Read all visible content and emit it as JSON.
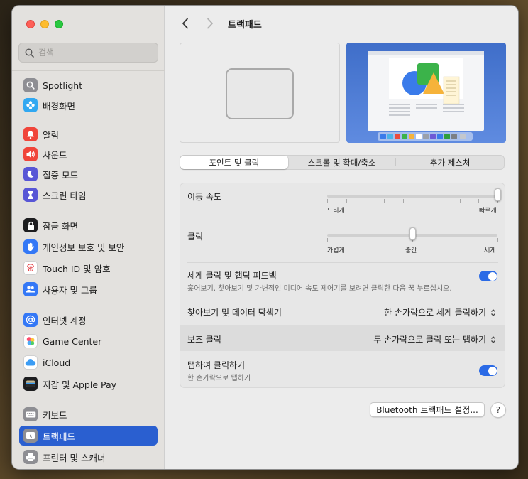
{
  "window": {
    "title": "트랙패드"
  },
  "search": {
    "placeholder": "검색"
  },
  "colors": {
    "accent": "#2a6ae6",
    "selection": "#2a5fd0"
  },
  "sidebar": {
    "items": [
      {
        "label": "Spotlight",
        "icon": "magnifier-icon",
        "color": "#8e8e93"
      },
      {
        "label": "배경화면",
        "icon": "flower-icon",
        "color": "#31a8f1"
      },
      {
        "label": "알림",
        "icon": "bell-icon",
        "color": "#f0453a"
      },
      {
        "label": "사운드",
        "icon": "speaker-icon",
        "color": "#f0453a"
      },
      {
        "label": "집중 모드",
        "icon": "moon-icon",
        "color": "#5856d6"
      },
      {
        "label": "스크린 타임",
        "icon": "hourglass-icon",
        "color": "#5856d6"
      },
      {
        "label": "잠금 화면",
        "icon": "lock-icon",
        "color": "#1d1d1f"
      },
      {
        "label": "개인정보 보호 및 보안",
        "icon": "hand-icon",
        "color": "#3478f6"
      },
      {
        "label": "Touch ID 및 암호",
        "icon": "fingerprint-icon",
        "color": "#ffffff"
      },
      {
        "label": "사용자 및 그룹",
        "icon": "users-icon",
        "color": "#3478f6"
      },
      {
        "label": "인터넷 계정",
        "icon": "at-icon",
        "color": "#3478f6"
      },
      {
        "label": "Game Center",
        "icon": "game-center-icon",
        "color": "#ffffff"
      },
      {
        "label": "iCloud",
        "icon": "cloud-icon",
        "color": "#ffffff"
      },
      {
        "label": "지갑 및 Apple Pay",
        "icon": "wallet-icon",
        "color": "#1d1d1f"
      },
      {
        "label": "키보드",
        "icon": "keyboard-icon",
        "color": "#8e8e93"
      },
      {
        "label": "트랙패드",
        "icon": "trackpad-icon",
        "color": "#8e8e93",
        "selected": true
      },
      {
        "label": "프린터 및 스캐너",
        "icon": "printer-icon",
        "color": "#8e8e93"
      }
    ]
  },
  "tabs": [
    "포인트 및 클릭",
    "스크롤 및 확대/축소",
    "추가 제스처"
  ],
  "settings": {
    "tracking_speed": {
      "title": "이동 속도",
      "min_label": "느리게",
      "max_label": "빠르게",
      "value": 1.0
    },
    "click": {
      "title": "클릭",
      "labels": [
        "가볍게",
        "중간",
        "세게"
      ],
      "value": 0.5
    },
    "force_click": {
      "title": "세게 클릭 및 햅틱 피드백",
      "description": "훑어보기, 찾아보기 및 가변적인 미디어 속도 제어기를 보려면 클릭한 다음 꾹 누르십시오.",
      "enabled": true
    },
    "lookup": {
      "title": "찾아보기 및 데이터 탐색기",
      "value": "한 손가락으로 세게 클릭하기"
    },
    "secondary_click": {
      "title": "보조 클릭",
      "value": "두 손가락으로 클릭 또는 탭하기"
    },
    "tap_to_click": {
      "title": "탭하여 클릭하기",
      "description": "한 손가락으로 탭하기",
      "enabled": true
    }
  },
  "footer": {
    "bluetooth_button": "Bluetooth 트랙패드 설정...",
    "help_button": "?"
  }
}
